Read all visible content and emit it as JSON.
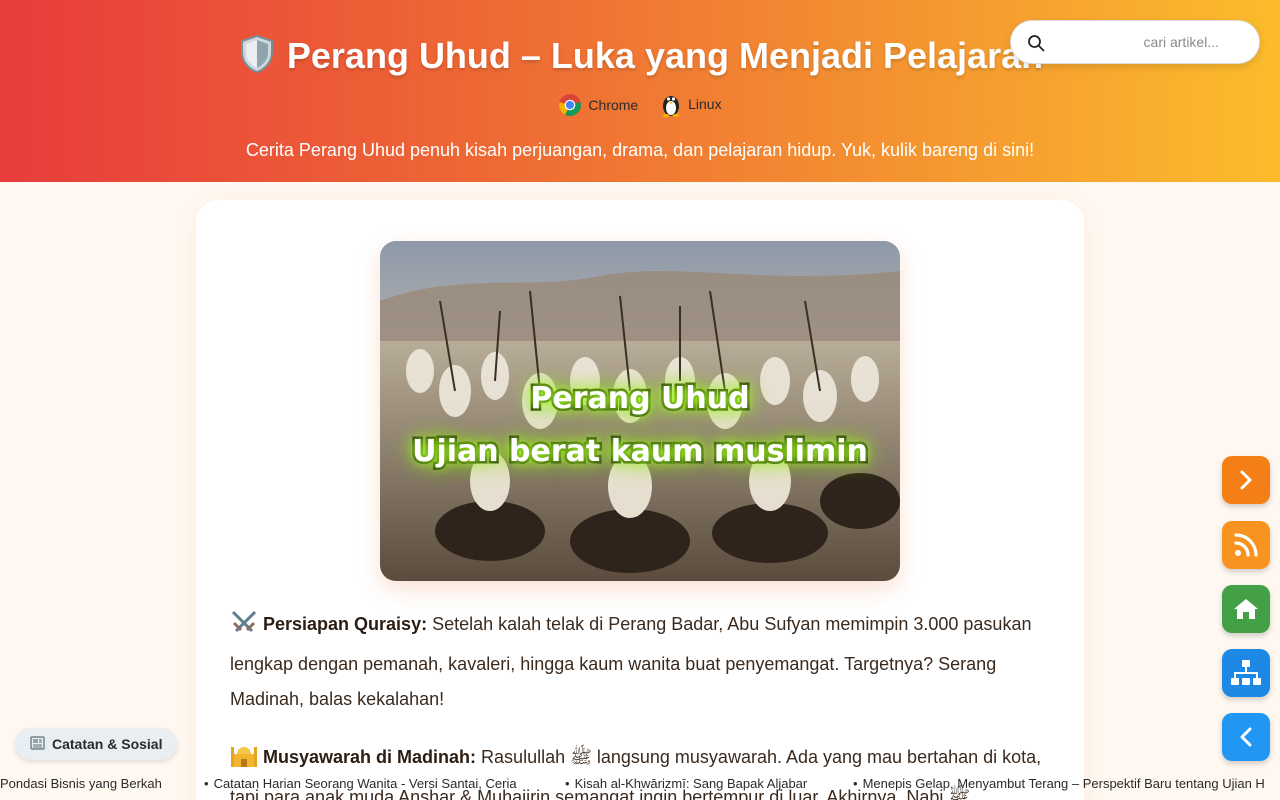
{
  "header": {
    "title_icon": "shield-icon",
    "title": "Perang Uhud – Luka yang Menjadi Pelajaran",
    "platforms": [
      {
        "label": "Chrome",
        "icon": "chrome-icon"
      },
      {
        "label": "Linux",
        "icon": "linux-penguin-icon"
      }
    ],
    "subtitle": "Cerita Perang Uhud penuh kisah perjuangan, drama, dan pelajaran hidup. Yuk, kulik bareng di sini!"
  },
  "search": {
    "placeholder": "cari artikel...",
    "value": ""
  },
  "article": {
    "image": {
      "caption_line1": "Perang Uhud",
      "caption_line2": "Ujian berat kaum muslimin"
    },
    "paragraphs": [
      {
        "icon": "crossed-swords-icon",
        "heading": "Persiapan Quraisy:",
        "text": " Setelah kalah telak di Perang Badar, Abu Sufyan memimpin 3.000 pasukan lengkap dengan pemanah, kavaleri, hingga kaum wanita buat penyemangat. Targetnya? Serang Madinah, balas kekalahan!"
      },
      {
        "icon": "mosque-icon",
        "heading": "Musyawarah di Madinah:",
        "text": " Rasulullah ﷺ langsung musyawarah. Ada yang mau bertahan di kota, tapi para anak muda Anshar & Muhajirin semangat ingin bertempur di luar. Akhirnya, Nabi ﷺ"
      }
    ]
  },
  "side_nav": [
    {
      "name": "next",
      "icon": "chevron-right-icon",
      "color": "#f57f17"
    },
    {
      "name": "rss",
      "icon": "rss-icon",
      "color": "#f7931e"
    },
    {
      "name": "home",
      "icon": "home-icon",
      "color": "#43a047"
    },
    {
      "name": "sitemap",
      "icon": "sitemap-icon",
      "color": "#1e88e5"
    },
    {
      "name": "back",
      "icon": "chevron-left-icon",
      "color": "#2196f3"
    }
  ],
  "category_pill": {
    "icon": "newspaper-icon",
    "label": "Catatan & Sosial"
  },
  "ticker": [
    "Pondasi Bisnis yang Berkah",
    "Catatan Harian Seorang Wanita - Versi Santai, Ceria",
    "Kisah al-Khwārizmī: Sang Bapak Aljabar",
    "Menepis Gelap, Menyambut Terang – Perspektif Baru tentang Ujian H"
  ],
  "ticker_bullet": "•"
}
